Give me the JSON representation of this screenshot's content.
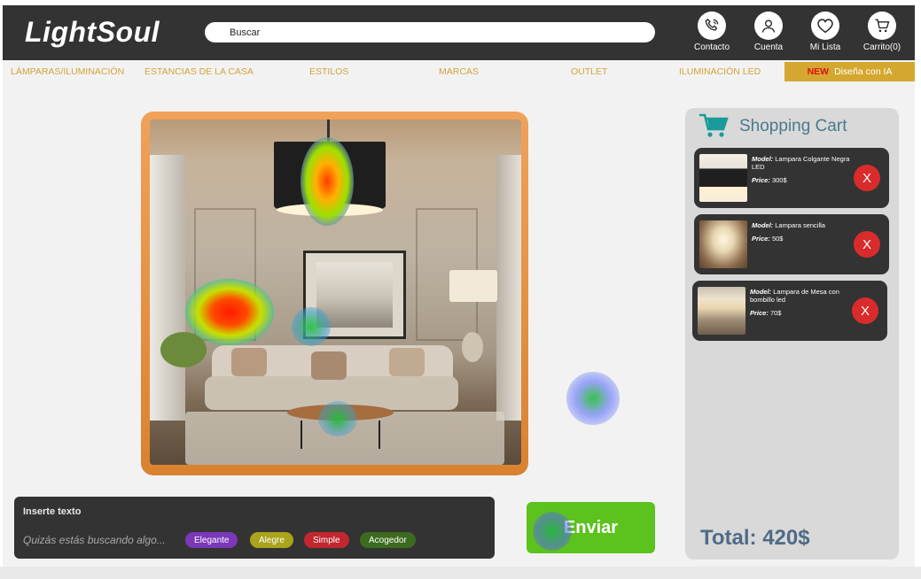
{
  "header": {
    "brand": "LightSoul",
    "search_placeholder": "Buscar",
    "icons": [
      {
        "label": "Contacto",
        "icon": "phone-icon"
      },
      {
        "label": "Cuenta",
        "icon": "user-icon"
      },
      {
        "label": "Mi Lista",
        "icon": "heart-icon"
      },
      {
        "label": "Carrito(0)",
        "icon": "cart-icon"
      }
    ]
  },
  "nav": {
    "items": [
      "LÁMPARAS/ILUMINACIÓN",
      "ESTANCIAS DE LA CASA",
      "ESTILOS",
      "MARCAS",
      "OUTLET",
      "ILUMINACIÓN LED"
    ],
    "new_badge": "NEW",
    "ia_label": "Diseña con IA"
  },
  "cart": {
    "title": "Shopping Cart",
    "model_key": "Model:",
    "price_key": "Price:",
    "remove_label": "X",
    "items": [
      {
        "model": "Lampara Colgante Negra LED",
        "price": "300$"
      },
      {
        "model": "Lampara sencilla",
        "price": "50$"
      },
      {
        "model": "Lampara de Mesa con bombillo led",
        "price": "70$"
      }
    ],
    "total": "Total: 420$"
  },
  "prompt": {
    "label": "Inserte texto",
    "placeholder": "Quizás estás buscando algo...",
    "chips": [
      {
        "label": "Elegante",
        "color": "#7b38b8"
      },
      {
        "label": "Alegre",
        "color": "#a9a41c"
      },
      {
        "label": "Simple",
        "color": "#c2262e"
      },
      {
        "label": "Acogedor",
        "color": "#3b6b1f"
      }
    ],
    "send_label": "Enviar"
  },
  "colors": {
    "header_bg": "#333333",
    "nav_text": "#d4a33a",
    "accent_orange": "#e08a38",
    "send_green": "#5cc21e",
    "remove_red": "#d92b2b"
  }
}
